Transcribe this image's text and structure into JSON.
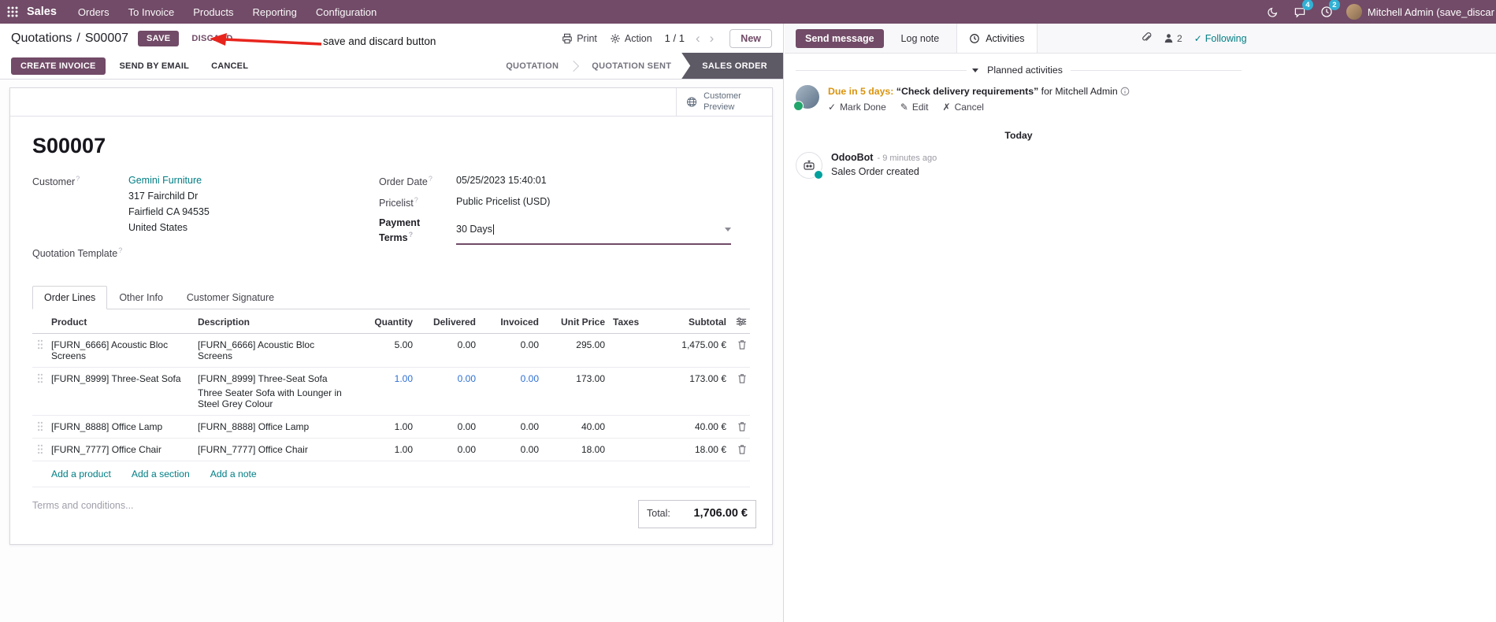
{
  "topbar": {
    "app_name": "Sales",
    "menus": [
      "Orders",
      "To Invoice",
      "Products",
      "Reporting",
      "Configuration"
    ],
    "chat_badge": "4",
    "clock_badge": "2",
    "user_name": "Mitchell Admin (save_discar"
  },
  "breadcrumb": {
    "parent": "Quotations",
    "sep": "/",
    "current": "S00007",
    "save": "SAVE",
    "discard": "DISCARD"
  },
  "annotation": {
    "label": "save and discard button"
  },
  "controls": {
    "print": "Print",
    "action": "Action",
    "pager": "1 / 1",
    "prev": "‹",
    "next": "›",
    "new": "New"
  },
  "action_buttons": {
    "create_invoice": "CREATE INVOICE",
    "send_by_email": "SEND BY EMAIL",
    "cancel": "CANCEL"
  },
  "statusbar": {
    "stages": [
      "QUOTATION",
      "QUOTATION SENT",
      "SALES ORDER"
    ],
    "active": "SALES ORDER"
  },
  "sheet": {
    "preview_button": "Customer Preview",
    "title": "S00007",
    "customer": {
      "label": "Customer",
      "help": "?",
      "name": "Gemini Furniture",
      "address_lines": [
        "317 Fairchild Dr",
        "Fairfield CA 94535",
        "United States"
      ]
    },
    "quotation_template": {
      "label": "Quotation Template",
      "help": "?"
    },
    "order_date": {
      "label": "Order Date",
      "help": "?",
      "value": "05/25/2023 15:40:01"
    },
    "pricelist": {
      "label": "Pricelist",
      "help": "?",
      "value": "Public Pricelist (USD)"
    },
    "payment_terms": {
      "label": "Payment Terms",
      "help": "?",
      "value": "30 Days"
    },
    "tabs": [
      {
        "label": "Order Lines"
      },
      {
        "label": "Other Info"
      },
      {
        "label": "Customer Signature"
      }
    ],
    "table": {
      "headers": {
        "product": "Product",
        "description": "Description",
        "quantity": "Quantity",
        "delivered": "Delivered",
        "invoiced": "Invoiced",
        "unit_price": "Unit Price",
        "taxes": "Taxes",
        "subtotal": "Subtotal"
      },
      "rows": [
        {
          "product": "[FURN_6666] Acoustic Bloc Screens",
          "description": "[FURN_6666] Acoustic Bloc Screens",
          "description2": "",
          "quantity": "5.00",
          "delivered": "0.00",
          "invoiced": "0.00",
          "unit_price": "295.00",
          "taxes": "",
          "subtotal": "1,475.00 €"
        },
        {
          "product": "[FURN_8999] Three-Seat Sofa",
          "description": "[FURN_8999] Three-Seat Sofa",
          "description2": "Three Seater Sofa with Lounger in Steel Grey Colour",
          "quantity": "1.00",
          "delivered": "0.00",
          "invoiced": "0.00",
          "unit_price": "173.00",
          "taxes": "",
          "subtotal": "173.00 €"
        },
        {
          "product": "[FURN_8888] Office Lamp",
          "description": "[FURN_8888] Office Lamp",
          "description2": "",
          "quantity": "1.00",
          "delivered": "0.00",
          "invoiced": "0.00",
          "unit_price": "40.00",
          "taxes": "",
          "subtotal": "40.00 €"
        },
        {
          "product": "[FURN_7777] Office Chair",
          "description": "[FURN_7777] Office Chair",
          "description2": "",
          "quantity": "1.00",
          "delivered": "0.00",
          "invoiced": "0.00",
          "unit_price": "18.00",
          "taxes": "",
          "subtotal": "18.00 €"
        }
      ],
      "add_product": "Add a product",
      "add_section": "Add a section",
      "add_note": "Add a note"
    },
    "terms_placeholder": "Terms and conditions...",
    "total": {
      "label": "Total:",
      "value": "1,706.00 €"
    }
  },
  "chatter": {
    "send_message": "Send message",
    "log_note": "Log note",
    "activities": "Activities",
    "followers_count": "2",
    "following": "Following",
    "following_check": "✓",
    "planned_activities": "Planned activities",
    "activity": {
      "due": "Due in 5 days:",
      "summary": "“Check delivery requirements”",
      "assignee": "for Mitchell Admin",
      "mark_done_check": "✓",
      "mark_done": "Mark Done",
      "edit_glyph": "✎",
      "edit": "Edit",
      "cancel_glyph": "✗",
      "cancel": "Cancel"
    },
    "date_separator": "Today",
    "message": {
      "author": "OdooBot",
      "time": "- 9 minutes ago",
      "body": "Sales Order created"
    }
  },
  "colors": {
    "brand": "#714B67",
    "link": "#017e84",
    "status_active_bg": "#5d5965",
    "systray_badge": "#31b1d4",
    "activity_due_warning": "#d9930d",
    "forecast_blue": "#2E6FD2",
    "annotation_red": "#e8251d"
  }
}
